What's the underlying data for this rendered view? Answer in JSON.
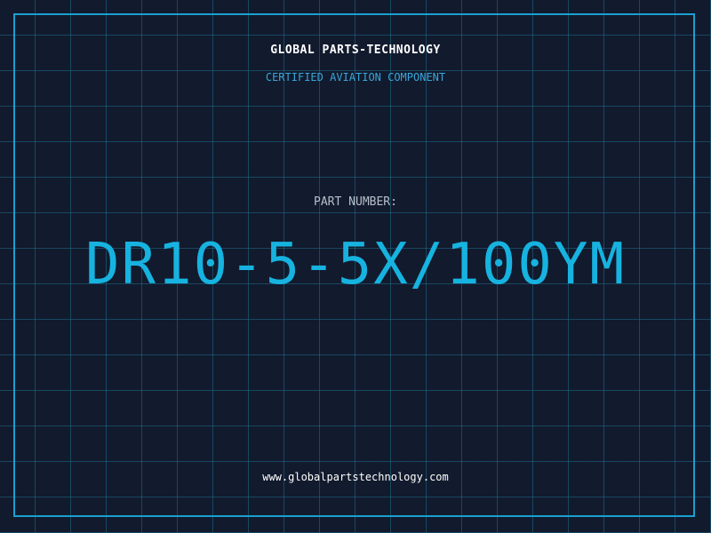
{
  "header": {
    "company": "GLOBAL PARTS-TECHNOLOGY",
    "subtitle": "CERTIFIED AVIATION COMPONENT"
  },
  "part": {
    "label": "PART NUMBER:",
    "number": "DR10-5-5X/100YM"
  },
  "footer": {
    "website": "www.globalpartstechnology.com"
  },
  "colors": {
    "background": "#121a2d",
    "grid": "#1c6e8c",
    "frame": "#1aa0d0",
    "accent": "#17b3e0",
    "subtitle": "#3aa6d8",
    "label": "#b8c0cc",
    "text": "#ffffff"
  }
}
